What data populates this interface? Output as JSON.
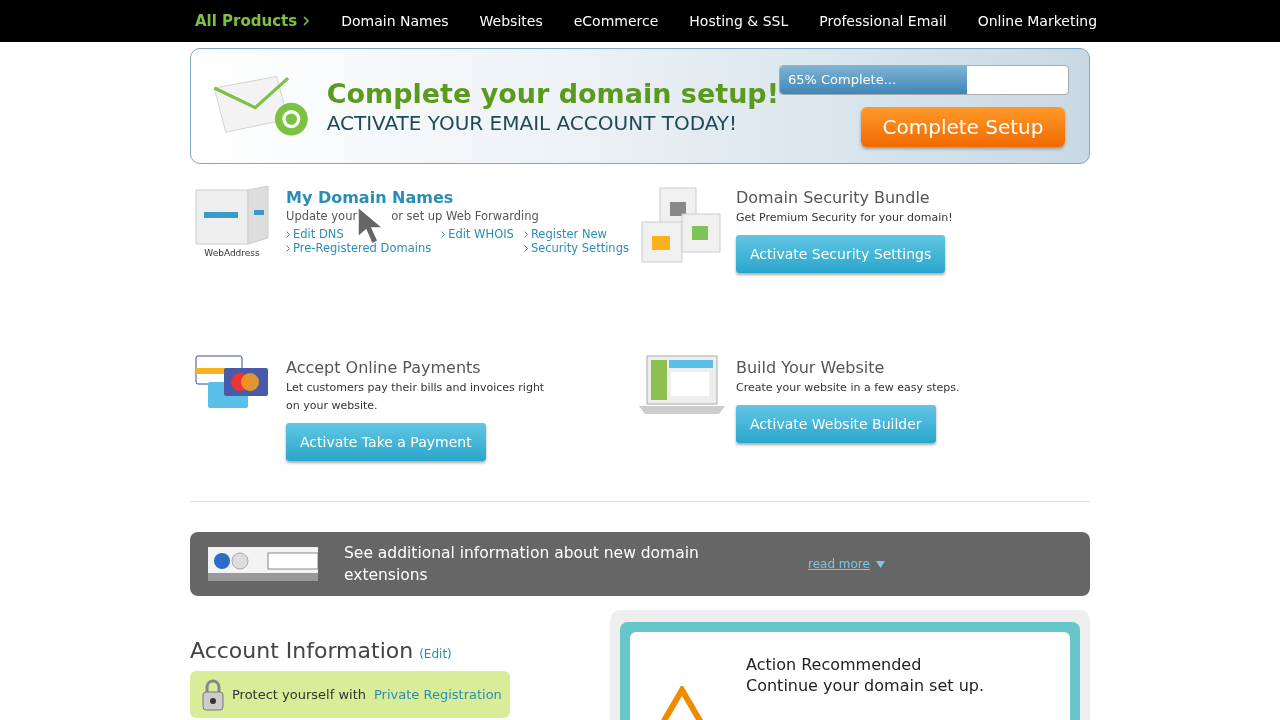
{
  "nav": [
    {
      "label": "All Products",
      "selected": true
    },
    {
      "label": "Domain Names",
      "selected": false
    },
    {
      "label": "Websites",
      "selected": false
    },
    {
      "label": "eCommerce",
      "selected": false
    },
    {
      "label": "Hosting & SSL",
      "selected": false
    },
    {
      "label": "Professional Email",
      "selected": false
    },
    {
      "label": "Online Marketing",
      "selected": false
    }
  ],
  "banner": {
    "title": "Complete your domain setup!",
    "subtitle": "ACTIVATE YOUR EMAIL ACCOUNT TODAY!",
    "progress": {
      "label": "65% Complete...",
      "level": 0.65
    },
    "button": "Complete Setup"
  },
  "features": [
    {
      "kind": "links",
      "title": "My Domain Names",
      "logo": "WebAddress",
      "description": [
        "Update your",
        "or set up Web Forwarding"
      ],
      "links": [
        [
          "Edit DNS",
          "Pre-Registered Domains"
        ],
        [
          "Edit WHOIS"
        ],
        [
          "Register New",
          "Security Settings"
        ]
      ]
    },
    {
      "kind": "action",
      "title": "Domain Security Bundle",
      "description": [
        "Get Premium Security for your domain!"
      ],
      "button": "Activate Security Settings"
    },
    {
      "kind": "action",
      "title": "Accept Online Payments",
      "description": [
        "Let customers pay their bills and invoices right on your website."
      ],
      "button": "Activate Take a Payment"
    },
    {
      "kind": "action",
      "title": "Build Your Website",
      "description": [
        "Create your website in a few easy steps."
      ],
      "button": "Activate Website Builder"
    }
  ],
  "info_bar": {
    "text": "See additional information about new domain extensions",
    "link": "read more"
  },
  "account": {
    "title": "Account Information",
    "edit": "(Edit)",
    "notice": {
      "text": "Protect yourself with",
      "link": "Private Registration"
    }
  },
  "action_panel": {
    "title": "Action Recommended",
    "text": "Continue your domain set up."
  }
}
